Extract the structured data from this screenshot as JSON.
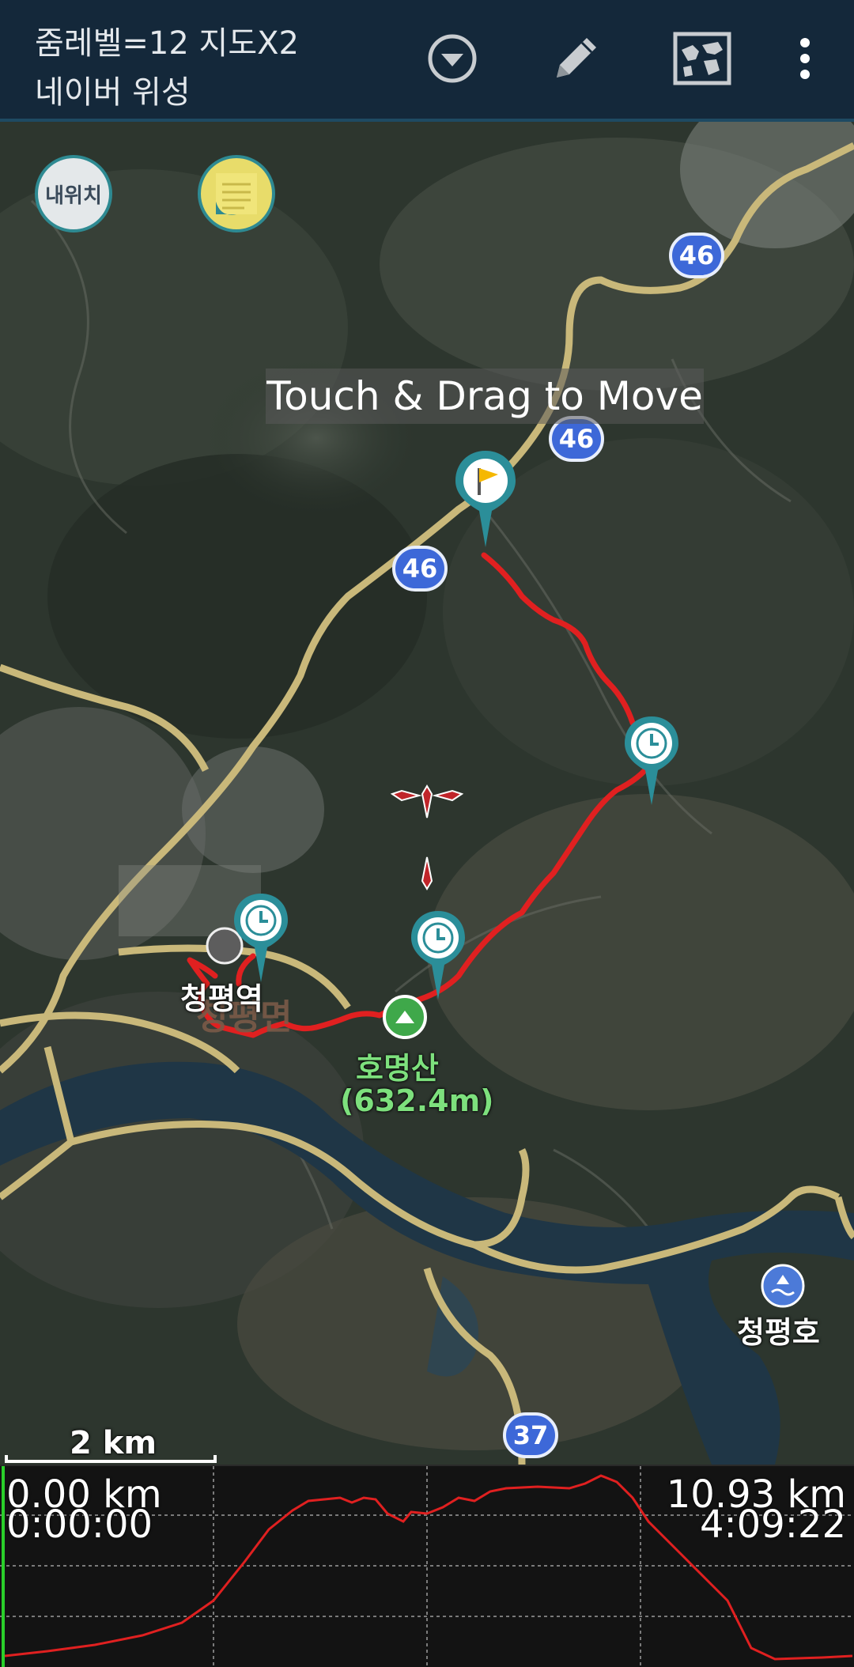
{
  "appbar": {
    "title_line1": "줌레벨=12 지도X2",
    "title_line2": "네이버 위성",
    "icons": [
      "dropdown-circle-icon",
      "pencil-icon",
      "map-icon",
      "more-vertical-icon"
    ]
  },
  "map": {
    "my_location_label": "내위치",
    "toast": "Touch & Drag to Move",
    "route_badges": [
      "46",
      "46",
      "46",
      "37"
    ],
    "places": {
      "station": "청평역",
      "district": "청평면",
      "mountain_name": "호명산",
      "mountain_height": "(632.4m)",
      "lake": "청평호"
    },
    "scale_label": "2 km",
    "colors": {
      "track": "#e02020",
      "pin": "#2b8e99",
      "road": "#c9b87a",
      "route_badge": "#3d68d8"
    }
  },
  "profile": {
    "start_distance": "0.00 km",
    "start_time": "0:00:00",
    "end_distance": "10.93 km",
    "end_time": "4:09:22",
    "line_color": "#e02020"
  }
}
